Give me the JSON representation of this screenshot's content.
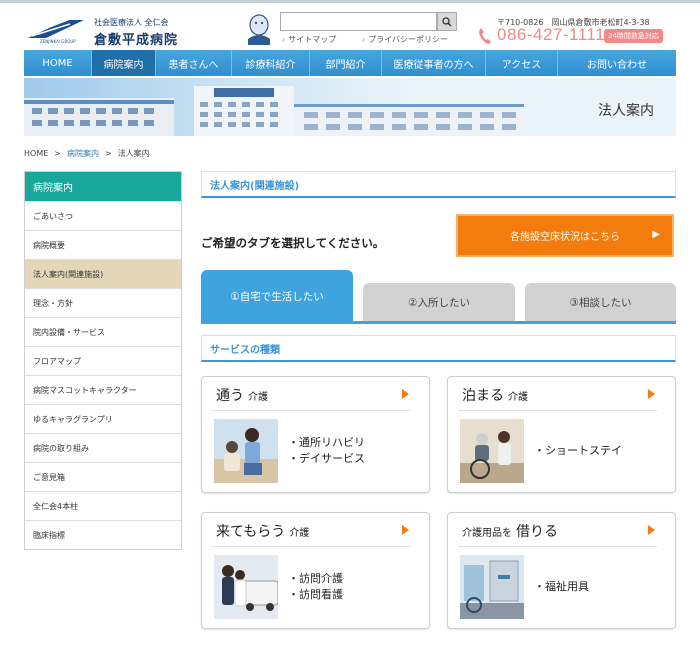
{
  "header": {
    "logo_small": "社会医療法人 全仁会",
    "logo_name": "倉敷平成病院",
    "logo_mark_text": "ZENJINKAI GROUP",
    "search_placeholder": "",
    "sitemap_link": "サイトマップ",
    "privacy_link": "プライバシーポリシー",
    "address": "〒710-0826　岡山県倉敷市老松町4-3-38",
    "phone": "086-427-1111",
    "phone_badge": "24時間救急対応"
  },
  "nav": {
    "items": [
      {
        "label": "HOME"
      },
      {
        "label": "病院案内"
      },
      {
        "label": "患者さんへ"
      },
      {
        "label": "診療科紹介"
      },
      {
        "label": "部門紹介"
      },
      {
        "label": "医療従事者の方へ"
      },
      {
        "label": "アクセス"
      },
      {
        "label": "お問い合わせ"
      }
    ],
    "active_index": 1
  },
  "banner": {
    "title": "法人案内"
  },
  "breadcrumb": {
    "home": "HOME",
    "parent": "病院案内",
    "current": "法人案内",
    "separator": ">"
  },
  "sidebar": {
    "heading": "病院案内",
    "items": [
      {
        "label": "ごあいさつ"
      },
      {
        "label": "病院概要"
      },
      {
        "label": "法人案内(関連施設)"
      },
      {
        "label": "理念・方針"
      },
      {
        "label": "院内設備・サービス"
      },
      {
        "label": "フロアマップ"
      },
      {
        "label": "病院マスコットキャラクター"
      },
      {
        "label": "ゆるキャラグランプリ"
      },
      {
        "label": "病院の取り組み"
      },
      {
        "label": "ご意見箱"
      },
      {
        "label": "全仁会4本柱"
      },
      {
        "label": "臨床指標"
      }
    ],
    "active_index": 2
  },
  "main": {
    "section_title": "法人案内(関連施設)",
    "prompt": "ご希望のタブを選択してください。",
    "vacancy_button": "各施設空床状況はこちら",
    "tabs": [
      {
        "label": "①自宅で生活したい"
      },
      {
        "label": "②入所したい"
      },
      {
        "label": "③相談したい"
      }
    ],
    "services_title": "サービスの種類",
    "cards": [
      {
        "title": "通う",
        "suffix": "介護",
        "items": [
          "・通所リハビリ",
          "・デイサービス"
        ]
      },
      {
        "title": "泊まる",
        "suffix": "介護",
        "items": [
          "・ショートステイ"
        ]
      },
      {
        "title": "来てもらう",
        "suffix": "介護",
        "items": [
          "・訪問介護",
          "・訪問看護"
        ]
      },
      {
        "prefix": "介護用品を",
        "title": "借りる",
        "items": [
          "・福祉用具"
        ]
      }
    ]
  },
  "colors": {
    "nav_blue": "#2f8fcf",
    "sidebar_teal": "#17a89b",
    "accent_orange": "#f47c0d",
    "phone_pink": "#f08a8a"
  }
}
